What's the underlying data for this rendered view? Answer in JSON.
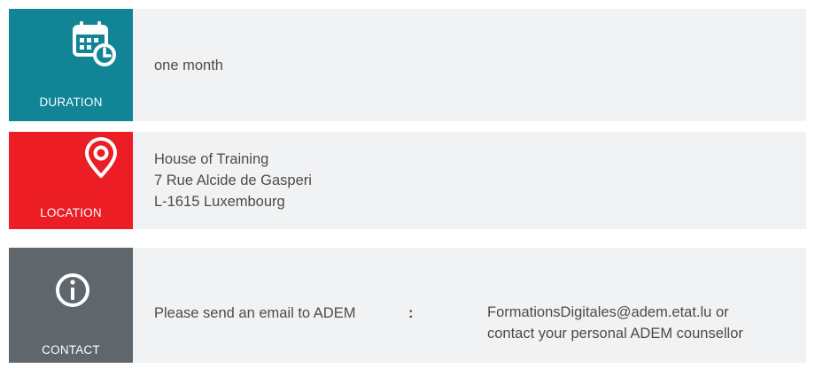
{
  "rows": [
    {
      "label": "DURATION",
      "icon": "calendar-clock-icon",
      "color": "#118496",
      "lines": [
        "one month"
      ]
    },
    {
      "label": "LOCATION",
      "icon": "map-pin-icon",
      "color": "#ec1d24",
      "lines": [
        "House of Training",
        "7 Rue Alcide de Gasperi",
        "L-1615 Luxembourg"
      ]
    },
    {
      "label": "CONTACT",
      "icon": "info-icon",
      "color": "#5f676c",
      "text": "Please send an email to ADEM",
      "separator": ":",
      "detail_lines": [
        "FormationsDigitales@adem.etat.lu or",
        "contact your personal ADEM counsellor"
      ]
    }
  ]
}
